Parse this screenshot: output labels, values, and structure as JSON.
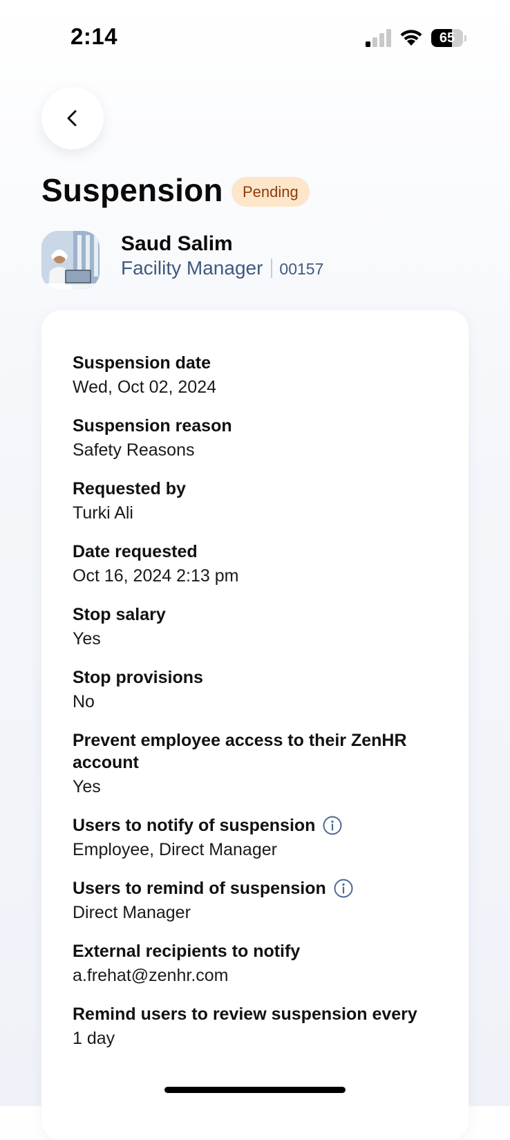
{
  "status_bar": {
    "time": "2:14",
    "battery_level": "65",
    "battery_fraction": 0.65,
    "signal_bars_active": 1,
    "signal_bars_total": 4
  },
  "header": {
    "title": "Suspension",
    "status": "Pending",
    "status_bg_color": "#fde6c9",
    "status_text_color": "#8a3d0c"
  },
  "employee": {
    "name": "Saud Salim",
    "role": "Facility Manager",
    "id": "00157"
  },
  "details": [
    {
      "label": "Suspension date",
      "value": "Wed, Oct 02, 2024",
      "info": false
    },
    {
      "label": "Suspension reason",
      "value": "Safety Reasons",
      "info": false
    },
    {
      "label": "Requested by",
      "value": "Turki Ali",
      "info": false
    },
    {
      "label": "Date requested",
      "value": "Oct 16, 2024 2:13 pm",
      "info": false
    },
    {
      "label": "Stop salary",
      "value": "Yes",
      "info": false
    },
    {
      "label": "Stop provisions",
      "value": "No",
      "info": false
    },
    {
      "label": "Prevent employee access to their ZenHR account",
      "value": "Yes",
      "info": false
    },
    {
      "label": "Users to notify of suspension",
      "value": "Employee, Direct Manager",
      "info": true
    },
    {
      "label": "Users to remind of suspension",
      "value": "Direct Manager",
      "info": true
    },
    {
      "label": "External recipients to notify",
      "value": "a.frehat@zenhr.com",
      "info": false
    },
    {
      "label": "Remind users to review suspension every",
      "value": "1 day",
      "info": false
    }
  ],
  "icons": {
    "back": "chevron-left-icon",
    "info": "info-circle-icon",
    "wifi": "wifi-icon",
    "signal": "cellular-signal-icon",
    "battery": "battery-icon"
  },
  "colors": {
    "accent_text": "#3e5a7e",
    "info_icon": "#4a6a93"
  }
}
